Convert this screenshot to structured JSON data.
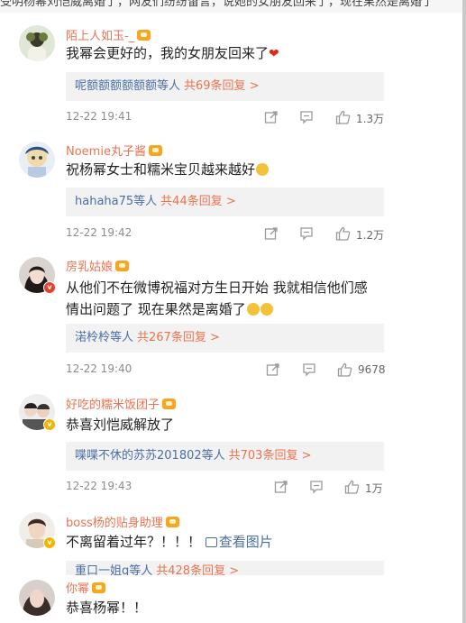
{
  "header": {
    "clipped_text": "受明杨幂刘恺威离婚了，网友们纷纷留言，说她的女朋友回来了，现在果然是离婚了"
  },
  "comments": [
    {
      "user": "陌上人如玉-_",
      "text": "我幂会更好的，我的女朋友回来了",
      "reply_names": "呢额额额额额额等人",
      "reply_count": "共69条回复 >",
      "time": "12-22 19:41",
      "likes": "1.3万"
    },
    {
      "user": "Noemie丸子酱",
      "text": "祝杨幂女士和糯米宝贝越来越好",
      "reply_names": "hahaha75等人",
      "reply_count": "共44条回复 >",
      "time": "12-22 19:42",
      "likes": "1.2万"
    },
    {
      "user": "房乳姑娘",
      "text_line1": "从他们不在微博祝福对方生日开始 我就相信他们感",
      "text_line2": "情出问题了 现在果然是离婚了",
      "reply_names": "渃柃柃等人",
      "reply_count": "共267条回复 >",
      "time": "12-22 19:40",
      "likes": "9678"
    },
    {
      "user": "好吃的糯米饭团子",
      "text": "恭喜刘恺威解放了",
      "reply_names": "喋喋不休的苏苏201802等人",
      "reply_count": "共703条回复 >",
      "time": "12-22 19:43",
      "likes": "1万"
    },
    {
      "user": "boss杨的贴身助理",
      "text": "不离留着过年？！！！",
      "pic_link": "查看图片",
      "reply_names": "重口一姐q等人",
      "reply_count": "共428条回复 >"
    },
    {
      "user": "你幂",
      "text": "恭喜杨幂！！"
    }
  ],
  "icons": {
    "share": "share-icon",
    "comment": "comment-icon",
    "like": "thumbs-up-icon",
    "crown": "vip-crown-icon"
  },
  "colors": {
    "username": "#eb7350",
    "link": "#4a6fa5",
    "reply_bg": "#f2f2f2",
    "meta": "#8c8c8c"
  }
}
